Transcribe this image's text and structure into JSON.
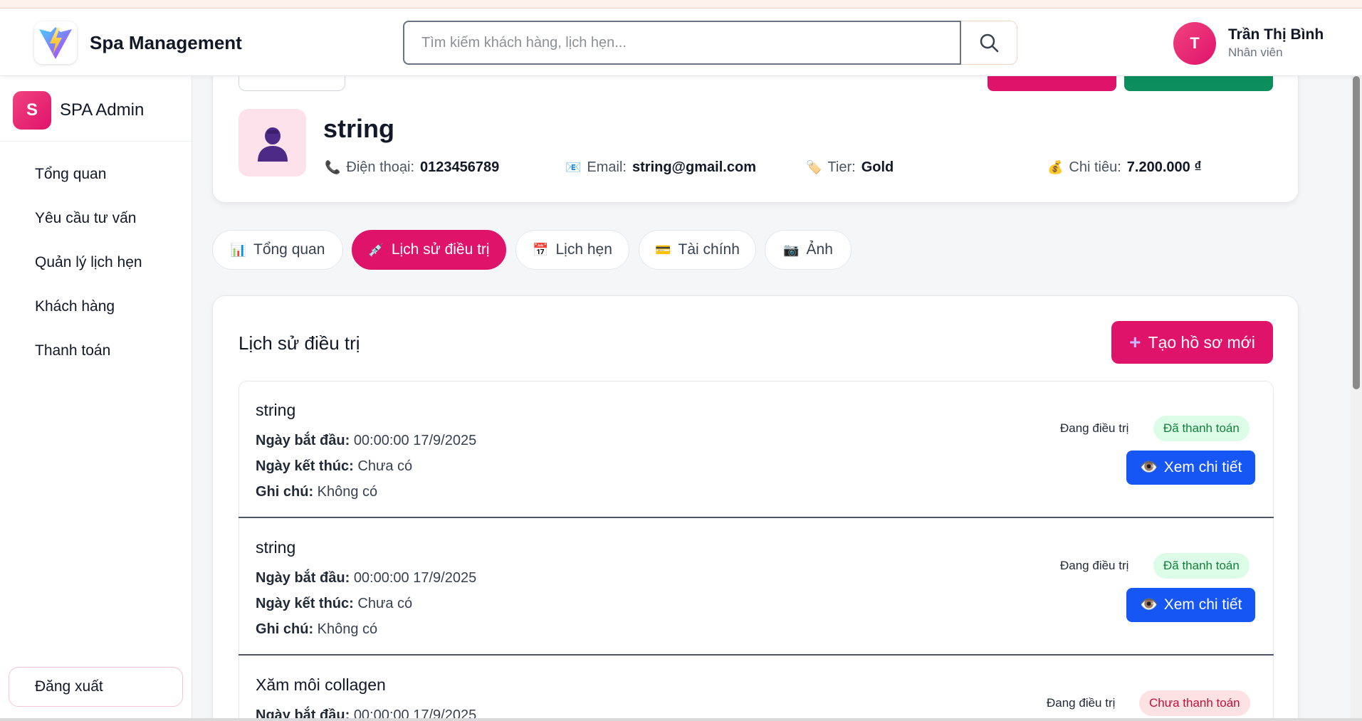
{
  "app": {
    "title": "Spa Management"
  },
  "search": {
    "placeholder": "Tìm kiếm khách hàng, lịch hẹn..."
  },
  "user": {
    "initial": "T",
    "name": "Trần Thị Bình",
    "role": "Nhân viên"
  },
  "sidebar": {
    "logo_letter": "S",
    "title": "SPA Admin",
    "items": [
      {
        "label": "Tổng quan"
      },
      {
        "label": "Yêu cầu tư vấn"
      },
      {
        "label": "Quản lý lịch hẹn"
      },
      {
        "label": "Khách hàng"
      },
      {
        "label": "Thanh toán"
      }
    ],
    "logout": "Đăng xuất"
  },
  "customer": {
    "name": "string",
    "phone_label": "Điện thoại:",
    "phone": "0123456789",
    "email_label": "Email:",
    "email": "string@gmail.com",
    "tier_label": "Tier:",
    "tier": "Gold",
    "spend_label": "Chi tiêu:",
    "spend": "7.200.000 ₫"
  },
  "tabs": [
    {
      "label": "Tổng quan",
      "icon": "bar-chart-icon",
      "active": false
    },
    {
      "label": "Lịch sử điều trị",
      "icon": "syringe-icon",
      "active": true
    },
    {
      "label": "Lịch hẹn",
      "icon": "calendar-icon",
      "active": false
    },
    {
      "label": "Tài chính",
      "icon": "credit-card-icon",
      "active": false
    },
    {
      "label": "Ảnh",
      "icon": "camera-icon",
      "active": false
    }
  ],
  "history": {
    "title": "Lịch sử điều trị",
    "create_label": "Tạo hồ sơ mới",
    "start_label": "Ngày bắt đầu:",
    "end_label": "Ngày kết thúc:",
    "note_label": "Ghi chú:",
    "view_label": "Xem chi tiết",
    "records": [
      {
        "name": "string",
        "start": "00:00:00 17/9/2025",
        "end": "Chưa có",
        "note": "Không có",
        "status": "Đang điều trị",
        "payment": "Đã thanh toán"
      },
      {
        "name": "string",
        "start": "00:00:00 17/9/2025",
        "end": "Chưa có",
        "note": "Không có",
        "status": "Đang điều trị",
        "payment": "Đã thanh toán"
      },
      {
        "name": "Xăm môi collagen",
        "start": "00:00:00 17/9/2025",
        "status": "Đang điều trị",
        "payment": "Chưa thanh toán"
      }
    ]
  },
  "colors": {
    "accent": "#e0136b",
    "primary_blue": "#1656f5",
    "success": "#0c8f5c"
  }
}
